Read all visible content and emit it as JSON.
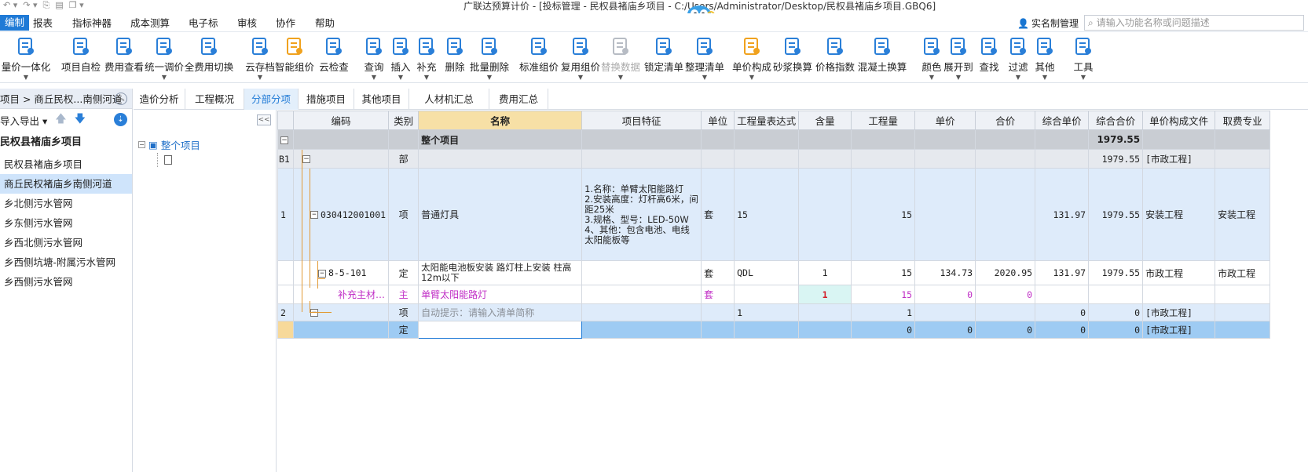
{
  "window": {
    "title": "广联达预算计价 - [投标管理 - 民权县褚庙乡项目 - C:/Users/Administrator/Desktop/民权县褚庙乡项目.GBQ6]"
  },
  "menu": {
    "items": [
      "编制",
      "报表",
      "指标神器",
      "成本测算",
      "电子标",
      "审核",
      "协作",
      "帮助"
    ],
    "realname": "实名制管理",
    "search_placeholder": "请输入功能名称或问题描述"
  },
  "toolbar": {
    "items": [
      {
        "label": "量价一体化",
        "dd": true
      },
      {
        "label": "项目自检",
        "dd": false
      },
      {
        "label": "费用查看",
        "dd": false
      },
      {
        "label": "统一调价",
        "dd": true
      },
      {
        "label": "全费用切换",
        "dd": false
      },
      {
        "label": "云存档",
        "dd": true
      },
      {
        "label": "智能组价",
        "dd": false
      },
      {
        "label": "云检查",
        "dd": false
      },
      {
        "label": "查询",
        "dd": true
      },
      {
        "label": "插入",
        "dd": true
      },
      {
        "label": "补充",
        "dd": true
      },
      {
        "label": "删除",
        "dd": false
      },
      {
        "label": "批量删除",
        "dd": true
      },
      {
        "label": "标准组价",
        "dd": false
      },
      {
        "label": "复用组价",
        "dd": true
      },
      {
        "label": "替换数据",
        "dd": true
      },
      {
        "label": "锁定清单",
        "dd": false
      },
      {
        "label": "整理清单",
        "dd": true
      },
      {
        "label": "单价构成",
        "dd": true
      },
      {
        "label": "砂浆换算",
        "dd": false
      },
      {
        "label": "价格指数",
        "dd": false
      },
      {
        "label": "混凝土换算",
        "dd": false
      },
      {
        "label": "颜色",
        "dd": true
      },
      {
        "label": "展开到",
        "dd": true
      },
      {
        "label": "查找",
        "dd": false
      },
      {
        "label": "过滤",
        "dd": true
      },
      {
        "label": "其他",
        "dd": true
      },
      {
        "label": "工具",
        "dd": true
      }
    ]
  },
  "left_panel": {
    "breadcrumb": "项目 > 商丘民权...南侧河道",
    "import_export": "导入导出",
    "project_title": "民权县褚庙乡项目",
    "items": [
      "民权县褚庙乡项目",
      "商丘民权褚庙乡南侧河道",
      "乡北侧污水管网",
      "乡东侧污水管网",
      "乡西北侧污水管网",
      "乡西侧坑塘-附属污水管网",
      "乡西侧污水管网"
    ],
    "selected_index": 1
  },
  "tree": {
    "root": "整个项目",
    "collapse": "<<"
  },
  "tabs": [
    "造价分析",
    "工程概况",
    "分部分项",
    "措施项目",
    "其他项目",
    "人材机汇总",
    "费用汇总"
  ],
  "grid": {
    "columns": [
      "编码",
      "类别",
      "名称",
      "项目特征",
      "单位",
      "工程量表达式",
      "含量",
      "工程量",
      "单价",
      "合价",
      "综合单价",
      "综合合价",
      "单价构成文件",
      "取费专业"
    ],
    "rows": {
      "root": {
        "name": "整个项目",
        "total": "1979.55"
      },
      "bu": {
        "seq": "B1",
        "type": "部",
        "total": "1979.55",
        "file": "[市政工程]"
      },
      "item1": {
        "seq": "1",
        "code": "030412001001",
        "type": "项",
        "name": "普通灯具",
        "feature": "1.名称：单臂太阳能路灯\n2.安装高度：灯杆高6米，间距25米\n3.规格、型号：LED-50W\n4、其他：包含电池、电线太阳能板等",
        "unit": "套",
        "expr": "15",
        "qty": "15",
        "unit_total": "131.97",
        "total": "1979.55",
        "file": "安装工程",
        "fee": "安装工程"
      },
      "ding1": {
        "code": "8-5-101",
        "type": "定",
        "name": "太阳能电池板安装 路灯柱上安装 柱高12m以下",
        "unit": "套",
        "expr": "QDL",
        "content": "1",
        "qty": "15",
        "price": "134.73",
        "amount": "2020.95",
        "unit_total": "131.97",
        "total": "1979.55",
        "file": "市政工程",
        "fee": "市政工程"
      },
      "zhu": {
        "code": "补充主材…",
        "type": "主",
        "name": "单臂太阳能路灯",
        "unit": "套",
        "content": "1",
        "qty": "15",
        "price": "0",
        "amount": "0"
      },
      "item2": {
        "seq": "2",
        "type": "项",
        "name": "自动提示：请输入清单简称",
        "expr": "1",
        "qty": "1",
        "unit_total": "0",
        "total": "0",
        "file": "[市政工程]"
      },
      "ding2": {
        "type": "定",
        "qty": "0",
        "price": "0",
        "amount": "0",
        "unit_total": "0",
        "total": "0",
        "file": "[市政工程]"
      }
    }
  },
  "colors": {
    "accent": "#1f7ad6",
    "selected_row": "#9ecbf3",
    "main_material": "#c02fc6",
    "name_header": "#f7e0a6"
  }
}
